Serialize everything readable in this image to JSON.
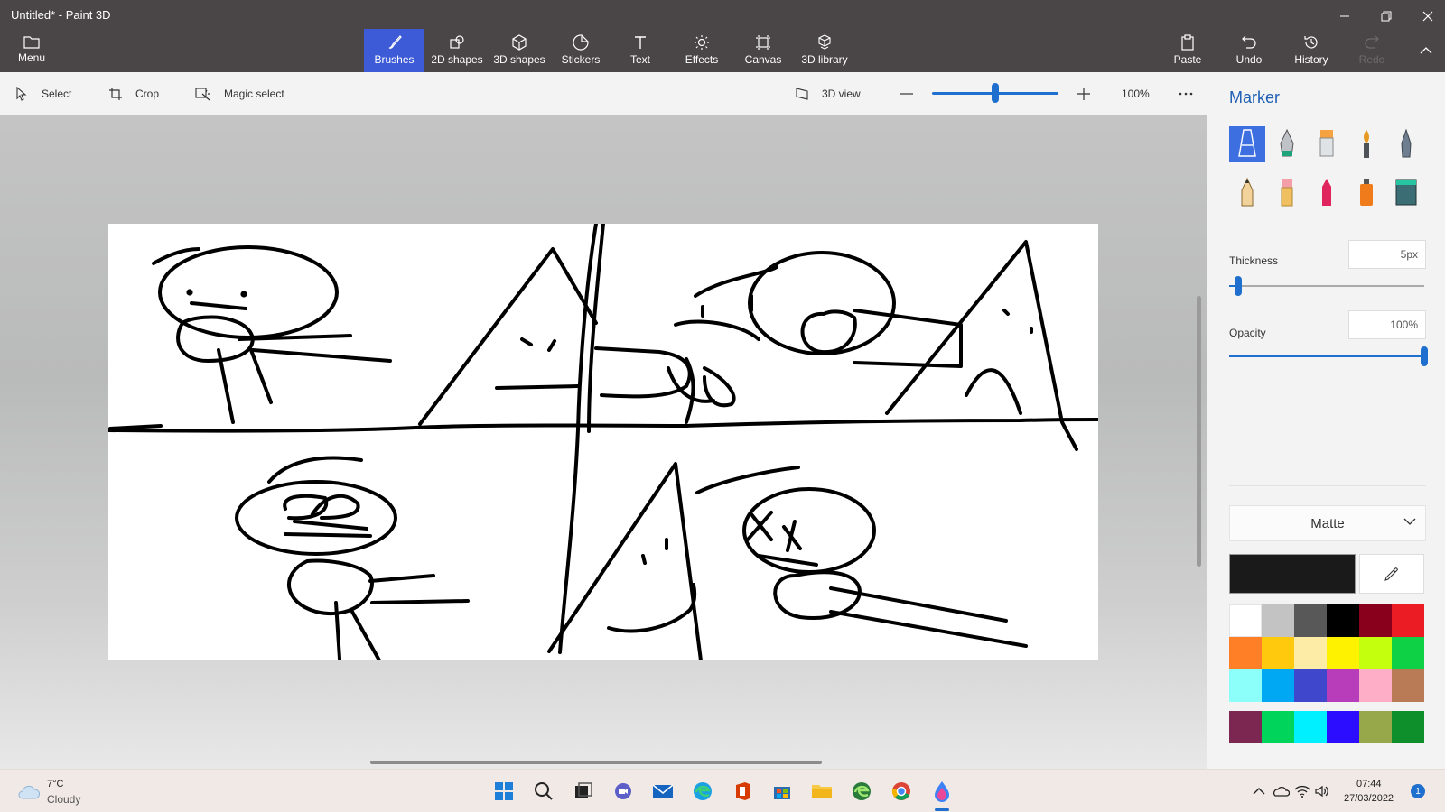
{
  "window": {
    "title": "Untitled* - Paint 3D"
  },
  "ribbon": {
    "menu_label": "Menu",
    "tabs": [
      {
        "label": "Brushes",
        "icon": "brush-icon",
        "active": true
      },
      {
        "label": "2D shapes",
        "icon": "2d-shapes-icon"
      },
      {
        "label": "3D shapes",
        "icon": "3d-shapes-icon"
      },
      {
        "label": "Stickers",
        "icon": "stickers-icon"
      },
      {
        "label": "Text",
        "icon": "text-icon"
      },
      {
        "label": "Effects",
        "icon": "effects-icon"
      },
      {
        "label": "Canvas",
        "icon": "canvas-icon"
      },
      {
        "label": "3D library",
        "icon": "3d-library-icon"
      }
    ],
    "actions": [
      {
        "label": "Paste",
        "icon": "paste-icon"
      },
      {
        "label": "Undo",
        "icon": "undo-icon"
      },
      {
        "label": "History",
        "icon": "history-icon"
      },
      {
        "label": "Redo",
        "icon": "redo-icon",
        "disabled": true
      }
    ]
  },
  "toolbar": {
    "select_label": "Select",
    "crop_label": "Crop",
    "magic_select_label": "Magic select",
    "view3d_label": "3D view",
    "zoom_value": "100%",
    "zoom_level": 0.49
  },
  "panel": {
    "title": "Marker",
    "brushes": [
      "marker-icon",
      "calligraphy-pen-icon",
      "oil-brush-icon",
      "watercolor-icon",
      "pixel-pen-icon",
      "pencil-icon",
      "eraser-icon",
      "crayon-icon",
      "spray-can-icon",
      "fill-bucket-icon"
    ],
    "thickness_label": "Thickness",
    "thickness_value": "5px",
    "thickness_level": 0.03,
    "opacity_label": "Opacity",
    "opacity_value": "100%",
    "opacity_level": 1.0,
    "finish": "Matte",
    "current_color": "#1a1a1a",
    "palette": [
      "#ffffff",
      "#c3c3c3",
      "#585858",
      "#000000",
      "#88001b",
      "#ec1c24",
      "#ff7f27",
      "#ffc90e",
      "#fdeca6",
      "#fff200",
      "#c4ff0e",
      "#0ed145",
      "#8cfffb",
      "#00a8f3",
      "#3f48cc",
      "#b83dba",
      "#ffaec8",
      "#b97a56"
    ],
    "custom_colors": [
      "#7b2752",
      "#00d45a",
      "#00f0ff",
      "#2c0dff",
      "#96a84a",
      "#0e8f2c"
    ]
  },
  "taskbar": {
    "weather_temp": "7°C",
    "weather_condition": "Cloudy",
    "time": "07:44",
    "date": "27/03/2022",
    "notification_count": "1"
  }
}
